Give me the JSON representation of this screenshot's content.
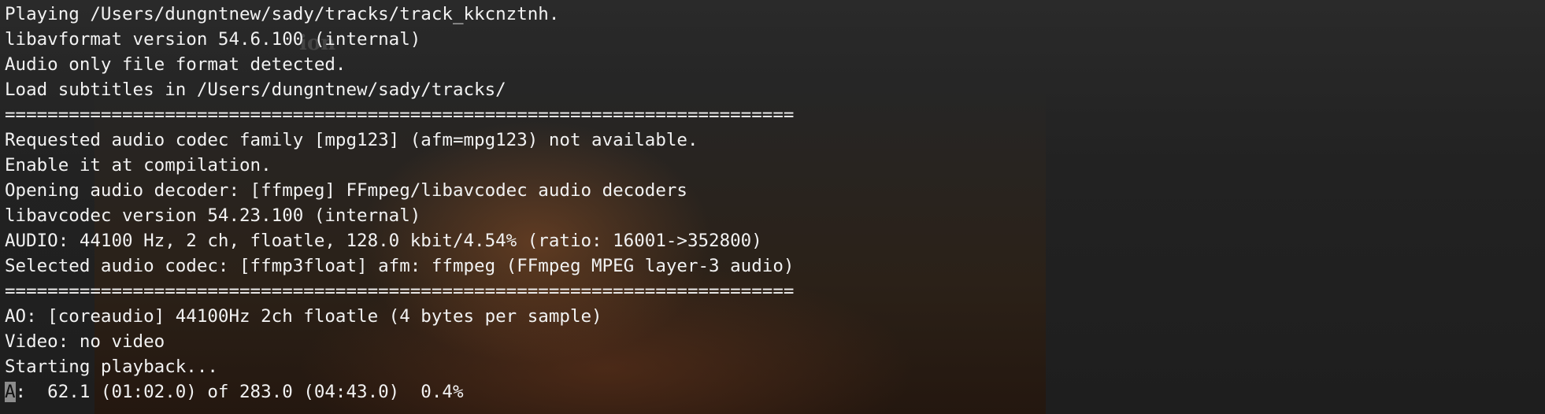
{
  "background": {
    "ghost_text": "ion"
  },
  "terminal": {
    "lines": [
      "Playing /Users/dungntnew/sady/tracks/track_kkcnztnh.",
      "libavformat version 54.6.100 (internal)",
      "Audio only file format detected.",
      "Load subtitles in /Users/dungntnew/sady/tracks/",
      "==========================================================================",
      "Requested audio codec family [mpg123] (afm=mpg123) not available.",
      "Enable it at compilation.",
      "Opening audio decoder: [ffmpeg] FFmpeg/libavcodec audio decoders",
      "libavcodec version 54.23.100 (internal)",
      "AUDIO: 44100 Hz, 2 ch, floatle, 128.0 kbit/4.54% (ratio: 16001->352800)",
      "Selected audio codec: [ffmp3float] afm: ffmpeg (FFmpeg MPEG layer-3 audio)",
      "==========================================================================",
      "AO: [coreaudio] 44100Hz 2ch floatle (4 bytes per sample)",
      "Video: no video",
      "Starting playback..."
    ],
    "status_prefix": "A",
    "status_rest": ":  62.1 (01:02.0) of 283.0 (04:43.0)  0.4%"
  },
  "colors": {
    "text": "#f2f2f2",
    "background": "#1b1b1b",
    "cursor": "#8c8c8c"
  }
}
